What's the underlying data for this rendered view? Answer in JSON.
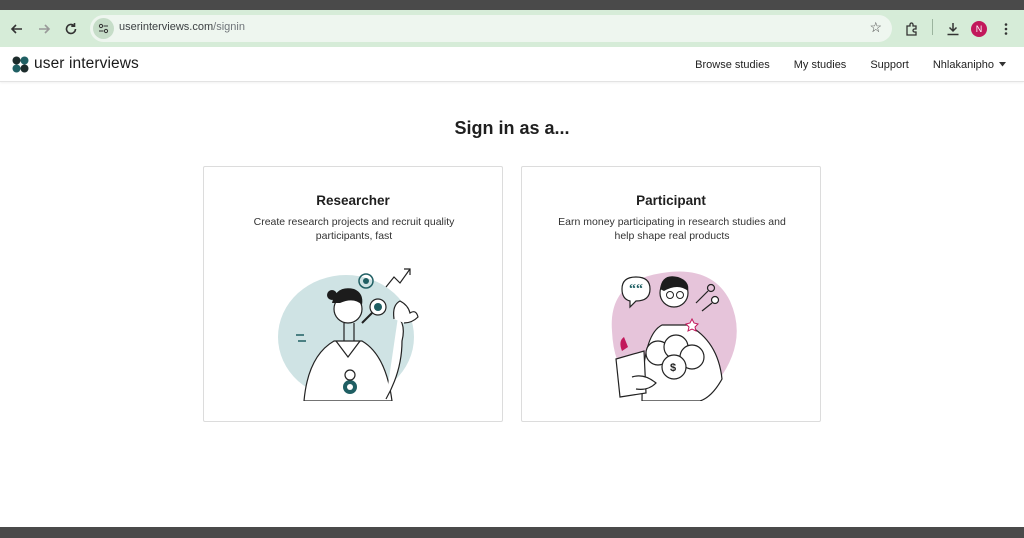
{
  "browser": {
    "url_host": "userinterviews.com",
    "url_path": "/signin",
    "profile_initial": "N"
  },
  "site": {
    "logo_text": "user interviews",
    "nav": {
      "browse": "Browse studies",
      "my_studies": "My studies",
      "support": "Support",
      "user": "Nhlakanipho"
    }
  },
  "main": {
    "title": "Sign in as a...",
    "cards": [
      {
        "title": "Researcher",
        "description": "Create research projects and recruit quality participants, fast"
      },
      {
        "title": "Participant",
        "description": "Earn money participating in research studies and help shape real products"
      }
    ]
  },
  "colors": {
    "accent_teal": "#1f5f63",
    "researcher_bg": "#cfe3e4",
    "participant_bg": "#e6c4da",
    "toolbar": "#d6ecd8"
  }
}
